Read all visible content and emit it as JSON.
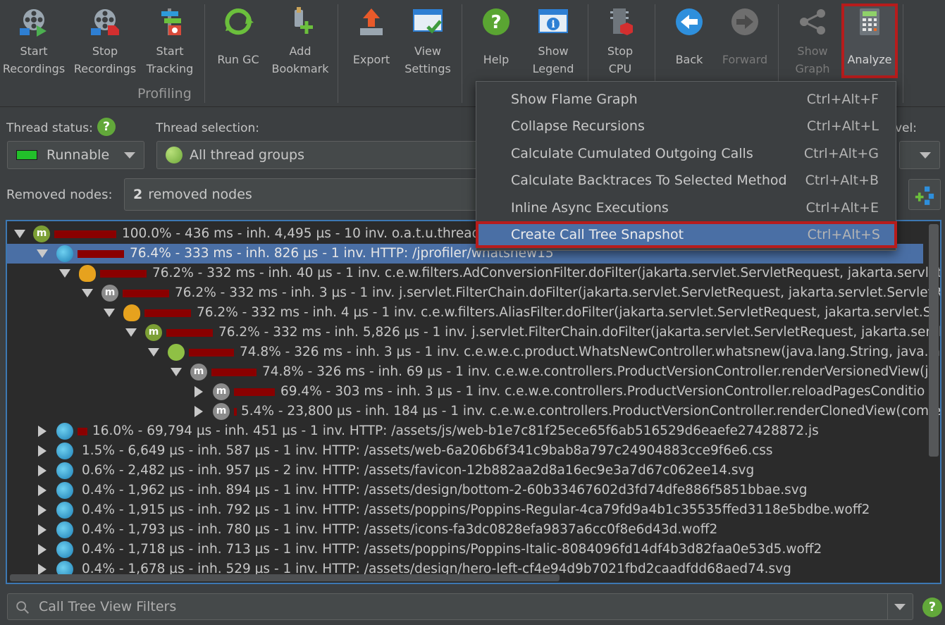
{
  "toolbar": {
    "buttons": [
      {
        "label": "Start\nRecordings",
        "icon": "film-reel-play-icon"
      },
      {
        "label": "Stop\nRecordings",
        "icon": "film-reel-stop-icon"
      },
      {
        "label": "Start\nTracking",
        "icon": "tracking-icon"
      },
      {
        "label": "Run GC",
        "icon": "recycle-icon"
      },
      {
        "label": "Add\nBookmark",
        "icon": "bookmark-add-icon"
      },
      {
        "label": "Export",
        "icon": "export-icon"
      },
      {
        "label": "View\nSettings",
        "icon": "view-settings-icon"
      },
      {
        "label": "Help",
        "icon": "help-icon"
      },
      {
        "label": "Show\nLegend",
        "icon": "legend-icon"
      },
      {
        "label": "Stop\nCPU",
        "icon": "cpu-stop-icon"
      },
      {
        "label": "Back",
        "icon": "back-arrow-icon"
      },
      {
        "label": "Forward",
        "icon": "forward-arrow-icon"
      },
      {
        "label": "Show\nGraph",
        "icon": "graph-icon"
      },
      {
        "label": "Analyze",
        "icon": "calculator-icon"
      }
    ],
    "group_label": "Profiling"
  },
  "filters": {
    "thread_status_label": "Thread status:",
    "thread_status_value": "Runnable",
    "thread_selection_label": "Thread selection:",
    "thread_selection_value": "All thread groups",
    "level_label_fragment": "vel:",
    "removed_nodes_label": "Removed nodes:",
    "removed_nodes_count": "2",
    "removed_nodes_text": "removed nodes"
  },
  "tree": {
    "rows": [
      {
        "text": "100.0% - 436 ms - inh. 4,495 µs - 10 inv. o.a.t.u.threads"
      },
      {
        "text": "76.4% - 333 ms - inh. 826 µs - 1 inv. HTTP: /jprofiler/whatsnew15"
      },
      {
        "text": "76.2% - 332 ms - inh. 40 µs - 1 inv. c.e.w.filters.AdConversionFilter.doFilter(jakarta.servlet.ServletRequest, jakarta.servlet.S"
      },
      {
        "text": "76.2% - 332 ms - inh. 3 µs - 1 inv. j.servlet.FilterChain.doFilter(jakarta.servlet.ServletRequest, jakarta.servlet.ServletRes"
      },
      {
        "text": "76.2% - 332 ms - inh. 4 µs - 1 inv. c.e.w.filters.AliasFilter.doFilter(jakarta.servlet.ServletRequest, jakarta.servlet.Serv"
      },
      {
        "text": "76.2% - 332 ms - inh. 5,826 µs - 1 inv. j.servlet.FilterChain.doFilter(jakarta.servlet.ServletRequest, jakarta.servle"
      },
      {
        "text": "74.8% - 326 ms - inh. 3 µs - 1 inv. c.e.w.e.c.product.WhatsNewController.whatsnew(java.lang.String, java.la"
      },
      {
        "text": "74.8% - 326 ms - inh. 69 µs - 1 inv. c.e.w.e.controllers.ProductVersionController.renderVersionedView(ja"
      },
      {
        "text": "69.4% - 303 ms - inh. 3 µs - 1 inv. c.e.w.e.controllers.ProductVersionController.reloadPagesConditio"
      },
      {
        "text": "5.4% - 23,800 µs - inh. 184 µs - 1 inv. c.e.w.e.controllers.ProductVersionController.renderClonedView(com.e"
      },
      {
        "text": "16.0% - 69,794 µs - inh. 451 µs - 1 inv. HTTP: /assets/js/web-b1e7c81f25ece65f6ab516529d6eaefe27428872.js"
      },
      {
        "text": "1.5% - 6,649 µs - inh. 587 µs - 1 inv. HTTP: /assets/web-6a206b6f341c9bab8a797c24904883cce9f6e6.css"
      },
      {
        "text": "0.6% - 2,482 µs - inh. 957 µs - 2 inv. HTTP: /assets/favicon-12b882aa2d8a16ec9e3a7d67c062ee14.svg"
      },
      {
        "text": "0.4% - 1,962 µs - inh. 894 µs - 1 inv. HTTP: /assets/design/bottom-2-60b33467602d3fd74dfe886f5851bbae.svg"
      },
      {
        "text": "0.4% - 1,915 µs - inh. 792 µs - 1 inv. HTTP: /assets/poppins/Poppins-Regular-4ca79fd9a4b1c35535ffed3118e5bdbe.woff2"
      },
      {
        "text": "0.4% - 1,793 µs - inh. 780 µs - 1 inv. HTTP: /assets/icons-fa3dc0828efa9837a6cc0f8e6d43d.woff2"
      },
      {
        "text": "0.4% - 1,718 µs - inh. 713 µs - 1 inv. HTTP: /assets/poppins/Poppins-Italic-8084096fd14df4b3d82faa0e53d5.woff2"
      },
      {
        "text": "0.4% - 1,678 µs - inh. 529 µs - 1 inv. HTTP: /assets/design/hero-left-cf4e94d9b7021fbd2caadfdd68aed74.svg"
      }
    ]
  },
  "menu": {
    "items": [
      {
        "label": "Show Flame Graph",
        "shortcut": "Ctrl+Alt+F"
      },
      {
        "label": "Collapse Recursions",
        "shortcut": "Ctrl+Alt+L"
      },
      {
        "label": "Calculate Cumulated Outgoing Calls",
        "shortcut": "Ctrl+Alt+G"
      },
      {
        "label": "Calculate Backtraces To Selected Method",
        "shortcut": "Ctrl+Alt+B"
      },
      {
        "label": "Inline Async Executions",
        "shortcut": "Ctrl+Alt+E"
      },
      {
        "label": "Create Call Tree Snapshot",
        "shortcut": "Ctrl+Alt+S"
      }
    ]
  },
  "bottom": {
    "filter_placeholder": "Call Tree View Filters"
  },
  "colors": {
    "accent_selection": "#4a6fa5",
    "highlight_frame": "#b71c1c",
    "bar": "#8a0000"
  }
}
